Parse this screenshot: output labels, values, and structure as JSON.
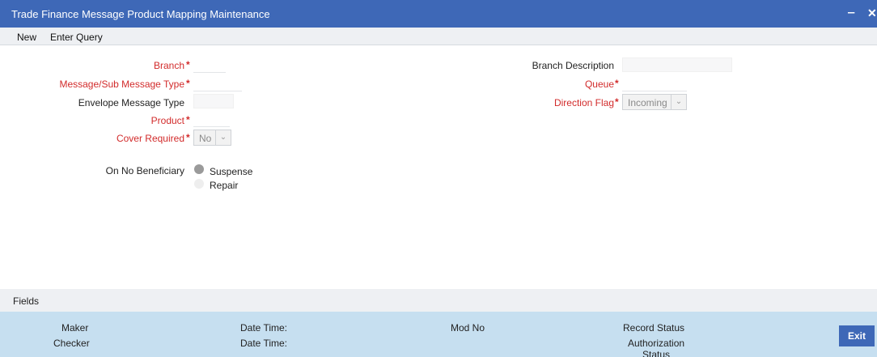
{
  "window": {
    "title": "Trade Finance Message Product Mapping Maintenance",
    "minimize_glyph": "‒",
    "close_glyph": "✕"
  },
  "menu": {
    "new": "New",
    "enter_query": "Enter Query"
  },
  "form": {
    "branch": {
      "label": "Branch",
      "required": "*",
      "value": ""
    },
    "message_type": {
      "label": "Message/Sub Message Type",
      "required": "*",
      "value": ""
    },
    "envelope_type": {
      "label": "Envelope Message Type",
      "value": ""
    },
    "product": {
      "label": "Product",
      "required": "*",
      "value": ""
    },
    "cover_required": {
      "label": "Cover Required",
      "required": "*",
      "value": "No"
    },
    "branch_description": {
      "label": "Branch Description",
      "value": ""
    },
    "queue": {
      "label": "Queue",
      "required": "*",
      "value": ""
    },
    "direction_flag": {
      "label": "Direction Flag",
      "required": "*",
      "value": "Incoming"
    },
    "on_no_beneficiary": {
      "label": "On No Beneficiary",
      "options": [
        {
          "label": "Suspense",
          "selected": true
        },
        {
          "label": "Repair",
          "selected": false
        }
      ]
    }
  },
  "footer": {
    "fields_label": "Fields",
    "maker": "Maker",
    "checker": "Checker",
    "maker_date": "Date Time:",
    "checker_date": "Date Time:",
    "mod_no": "Mod No",
    "record_status": "Record Status",
    "authorization_status": "Authorization Status",
    "exit": "Exit"
  },
  "colors": {
    "title_bar": "#3e68b7",
    "required_label": "#d22b2b",
    "audit_bar": "#c6dff0"
  }
}
